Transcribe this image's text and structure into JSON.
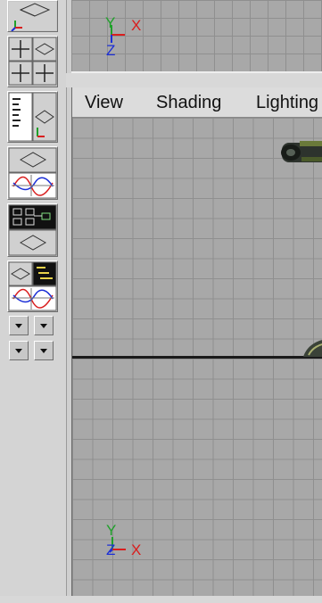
{
  "menubar": {
    "items": [
      "View",
      "Shading",
      "Lighting"
    ]
  },
  "axes": {
    "y": "Y",
    "x": "X",
    "z": "Z"
  },
  "colors": {
    "x_axis": "#d91e1e",
    "y_axis": "#1fa02a",
    "z_axis": "#1c2fd6",
    "grid": "#a8a8a8",
    "gridline": "#8f8f8f",
    "horizon": "#1a1a1a"
  },
  "toolbar": {
    "icons": [
      "single-perspective-layout-icon",
      "four-view-layout-icon",
      "outliner-perspective-layout-icon",
      "perspective-graph-editor-layout-icon",
      "hypershade-perspective-layout-icon",
      "outliner-perspective-graph-layout-icon",
      "panel-arrow-icon"
    ]
  }
}
